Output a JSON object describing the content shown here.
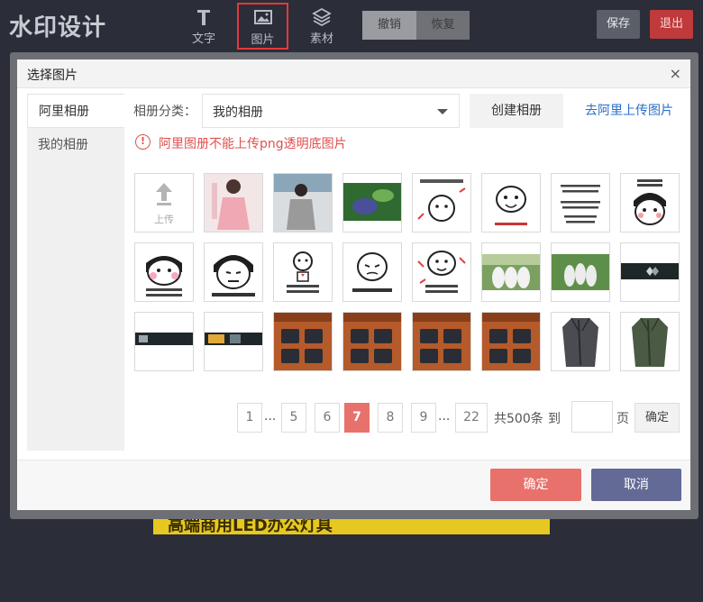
{
  "app": {
    "logo": "水印设计"
  },
  "toolbar": {
    "text_tool": "文字",
    "image_tool": "图片",
    "material_tool": "素材",
    "undo": "撤销",
    "redo": "恢复",
    "save": "保存",
    "exit": "退出"
  },
  "canvas": {
    "banner_text": "高端商用LED办公灯具"
  },
  "dialog": {
    "title": "选择图片",
    "close": "×",
    "sidebar": [
      "阿里相册",
      "我的相册"
    ],
    "category_label": "相册分类：",
    "category_value": "我的相册",
    "create_album": "创建相册",
    "upload_to_ali": "去阿里上传图片",
    "warning_icon": "!",
    "warning": "阿里图册不能上传png透明底图片",
    "upload_label": "上传",
    "thumbnails": [
      {
        "icon": "girl-pink-dress-photo",
        "caption": ""
      },
      {
        "icon": "girl-gray-sweater-photo",
        "caption": ""
      },
      {
        "icon": "nature-green-photo",
        "caption": ""
      },
      {
        "icon": "meme-sticker",
        "caption": "对你满满的都是爱"
      },
      {
        "icon": "meme-sticker",
        "caption": "我那你说我超爱你"
      },
      {
        "icon": "text-card",
        "caption": "遇到喜欢的东西就把它买下来"
      },
      {
        "icon": "meme-sticker",
        "caption": "心动在这，你在哪儿了?"
      },
      {
        "icon": "meme-sticker",
        "caption": "我这么可爱 你要不要来抱抱下"
      },
      {
        "icon": "meme-sticker",
        "caption": "有时想想真的累"
      },
      {
        "icon": "meme-sticker",
        "caption": "现在只喜欢 那种温柔的"
      },
      {
        "icon": "meme-sticker",
        "caption": "只对我温柔的"
      },
      {
        "icon": "meme-sticker",
        "caption": "风里雨里 我的心属于你"
      },
      {
        "icon": "group-photo",
        "caption": ""
      },
      {
        "icon": "group-photo",
        "caption": ""
      },
      {
        "icon": "dark-banner",
        "caption": ""
      },
      {
        "icon": "dark-banner",
        "caption": ""
      },
      {
        "icon": "dark-banner",
        "caption": ""
      },
      {
        "icon": "phone-case-product",
        "caption": ""
      },
      {
        "icon": "phone-case-product",
        "caption": ""
      },
      {
        "icon": "phone-case-product",
        "caption": ""
      },
      {
        "icon": "phone-case-product",
        "caption": ""
      },
      {
        "icon": "coat-product",
        "caption": ""
      },
      {
        "icon": "coat-product",
        "caption": ""
      }
    ],
    "pagination": {
      "pages": [
        "1",
        "5",
        "6",
        "7",
        "8",
        "9",
        "22"
      ],
      "current": "7",
      "ellipsis": "...",
      "total": "共500条",
      "goto": "到",
      "page_unit": "页",
      "confirm": "确定"
    },
    "ok": "确定",
    "cancel": "取消"
  },
  "colors": {
    "accent": "#e8716c",
    "cancel": "#636a96",
    "warning": "#e05050",
    "link": "#2a6fc9"
  }
}
